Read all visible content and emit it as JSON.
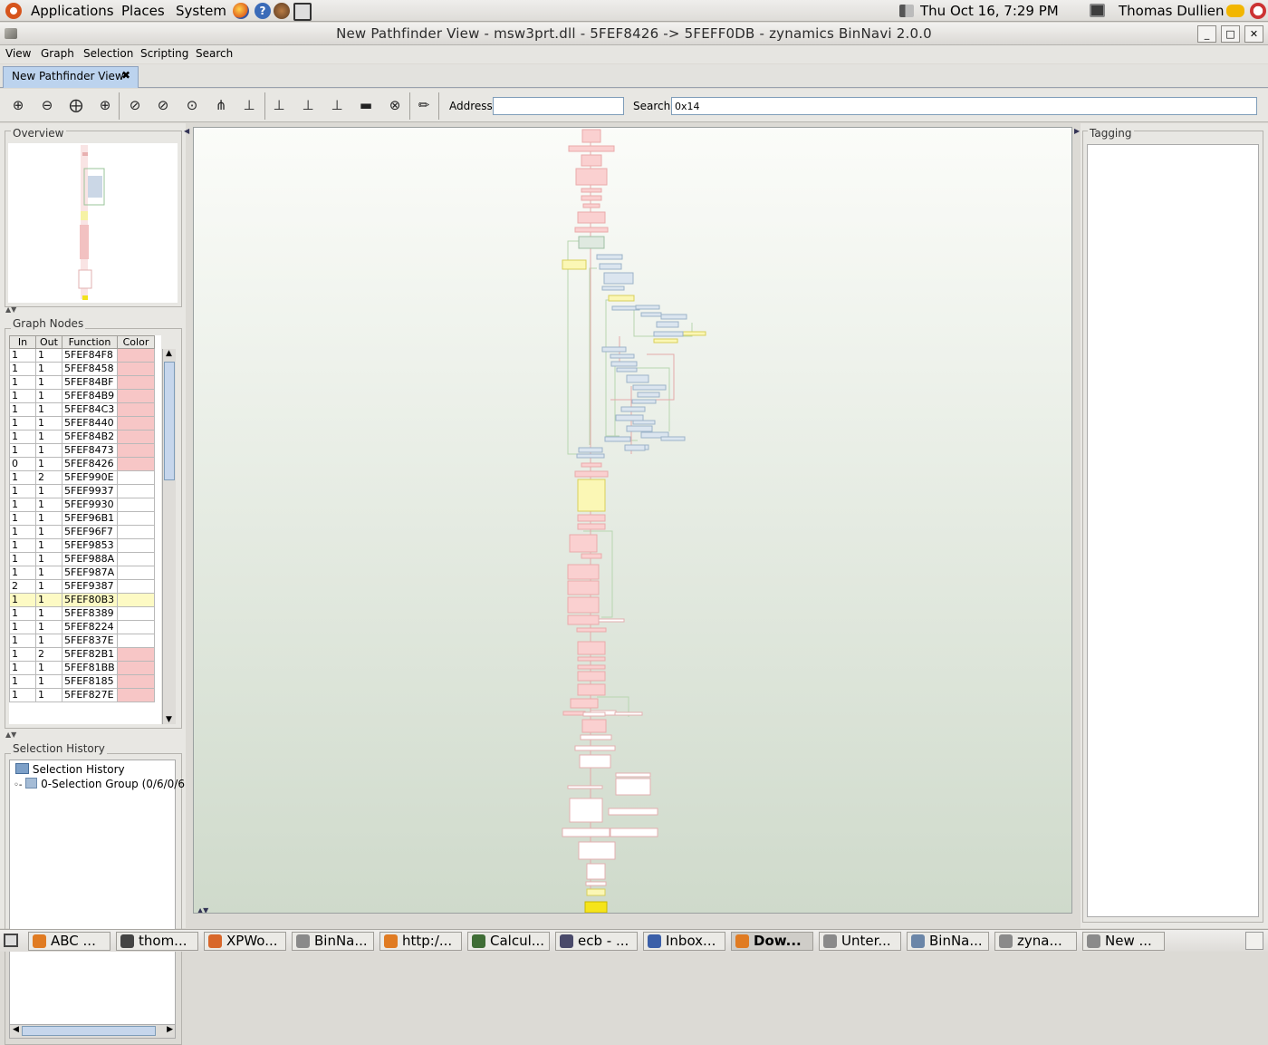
{
  "top_panel": {
    "menus": [
      "Applications",
      "Places",
      "System"
    ],
    "datetime": "Thu Oct 16,  7:29 PM",
    "user": "Thomas Dullien"
  },
  "window": {
    "title": "New Pathfinder View - msw3prt.dll - 5FEF8426 -> 5FEFF0DB - zynamics BinNavi 2.0.0"
  },
  "menubar": [
    "View",
    "Graph",
    "Selection",
    "Scripting",
    "Search"
  ],
  "tab": {
    "label": "New Pathfinder View"
  },
  "toolbar": {
    "address_label": "Address",
    "address_value": "",
    "search_label": "Search",
    "search_value": "0x14"
  },
  "overview": {
    "title": "Overview"
  },
  "graph_nodes": {
    "title": "Graph Nodes",
    "columns": [
      "In",
      "Out",
      "Function",
      "Color"
    ],
    "rows": [
      {
        "in": "1",
        "out": "1",
        "fn": "5FEF84F8",
        "color": "#f7c6c6"
      },
      {
        "in": "1",
        "out": "1",
        "fn": "5FEF8458",
        "color": "#f7c6c6"
      },
      {
        "in": "1",
        "out": "1",
        "fn": "5FEF84BF",
        "color": "#f7c6c6"
      },
      {
        "in": "1",
        "out": "1",
        "fn": "5FEF84B9",
        "color": "#f7c6c6"
      },
      {
        "in": "1",
        "out": "1",
        "fn": "5FEF84C3",
        "color": "#f7c6c6"
      },
      {
        "in": "1",
        "out": "1",
        "fn": "5FEF8440",
        "color": "#f7c6c6"
      },
      {
        "in": "1",
        "out": "1",
        "fn": "5FEF84B2",
        "color": "#f7c6c6"
      },
      {
        "in": "1",
        "out": "1",
        "fn": "5FEF8473",
        "color": "#f7c6c6"
      },
      {
        "in": "0",
        "out": "1",
        "fn": "5FEF8426",
        "color": "#f7c6c6"
      },
      {
        "in": "1",
        "out": "2",
        "fn": "5FEF990E",
        "color": "#ffffff"
      },
      {
        "in": "1",
        "out": "1",
        "fn": "5FEF9937",
        "color": "#ffffff"
      },
      {
        "in": "1",
        "out": "1",
        "fn": "5FEF9930",
        "color": "#ffffff"
      },
      {
        "in": "1",
        "out": "1",
        "fn": "5FEF96B1",
        "color": "#ffffff"
      },
      {
        "in": "1",
        "out": "1",
        "fn": "5FEF96F7",
        "color": "#ffffff"
      },
      {
        "in": "1",
        "out": "1",
        "fn": "5FEF9853",
        "color": "#ffffff"
      },
      {
        "in": "1",
        "out": "1",
        "fn": "5FEF988A",
        "color": "#ffffff"
      },
      {
        "in": "1",
        "out": "1",
        "fn": "5FEF987A",
        "color": "#ffffff"
      },
      {
        "in": "2",
        "out": "1",
        "fn": "5FEF9387",
        "color": "#ffffff"
      },
      {
        "in": "1",
        "out": "1",
        "fn": "5FEF80B3",
        "color": "#fdfac4",
        "highlight": true
      },
      {
        "in": "1",
        "out": "1",
        "fn": "5FEF8389",
        "color": "#ffffff"
      },
      {
        "in": "1",
        "out": "1",
        "fn": "5FEF8224",
        "color": "#ffffff"
      },
      {
        "in": "1",
        "out": "1",
        "fn": "5FEF837E",
        "color": "#ffffff"
      },
      {
        "in": "1",
        "out": "2",
        "fn": "5FEF82B1",
        "color": "#f7c6c6"
      },
      {
        "in": "1",
        "out": "1",
        "fn": "5FEF81BB",
        "color": "#f7c6c6"
      },
      {
        "in": "1",
        "out": "1",
        "fn": "5FEF8185",
        "color": "#f7c6c6"
      },
      {
        "in": "1",
        "out": "1",
        "fn": "5FEF827E",
        "color": "#f7c6c6"
      }
    ]
  },
  "selection_history": {
    "title": "Selection History",
    "root": "Selection History",
    "child": "0-Selection Group (0/6/0/6"
  },
  "tagging": {
    "title": "Tagging"
  },
  "taskbar": [
    {
      "label": "ABC ...",
      "icon": "firefox-icon",
      "color": "#e07b22"
    },
    {
      "label": "thom...",
      "icon": "terminal-icon",
      "color": "#444444"
    },
    {
      "label": "XPWo...",
      "icon": "vmware-icon",
      "color": "#d8672a"
    },
    {
      "label": "BinNa...",
      "icon": "document-icon",
      "color": "#8a8a8a"
    },
    {
      "label": "http:/...",
      "icon": "firefox-icon",
      "color": "#e07b22"
    },
    {
      "label": "Calcul...",
      "icon": "calculator-icon",
      "color": "#3f6d35"
    },
    {
      "label": "ecb - ...",
      "icon": "ecb-icon",
      "color": "#4a4a6a"
    },
    {
      "label": "Inbox...",
      "icon": "thunderbird-icon",
      "color": "#3b5fa8"
    },
    {
      "label": "Dow...",
      "icon": "firefox-icon",
      "color": "#e07b22",
      "active": true
    },
    {
      "label": "Unter...",
      "icon": "document-icon",
      "color": "#8a8a8a"
    },
    {
      "label": "BinNa...",
      "icon": "binnavi-icon",
      "color": "#6b86a8"
    },
    {
      "label": "zyna...",
      "icon": "java-icon",
      "color": "#8a8a8a"
    },
    {
      "label": "New ...",
      "icon": "java-icon",
      "color": "#8a8a8a"
    }
  ]
}
